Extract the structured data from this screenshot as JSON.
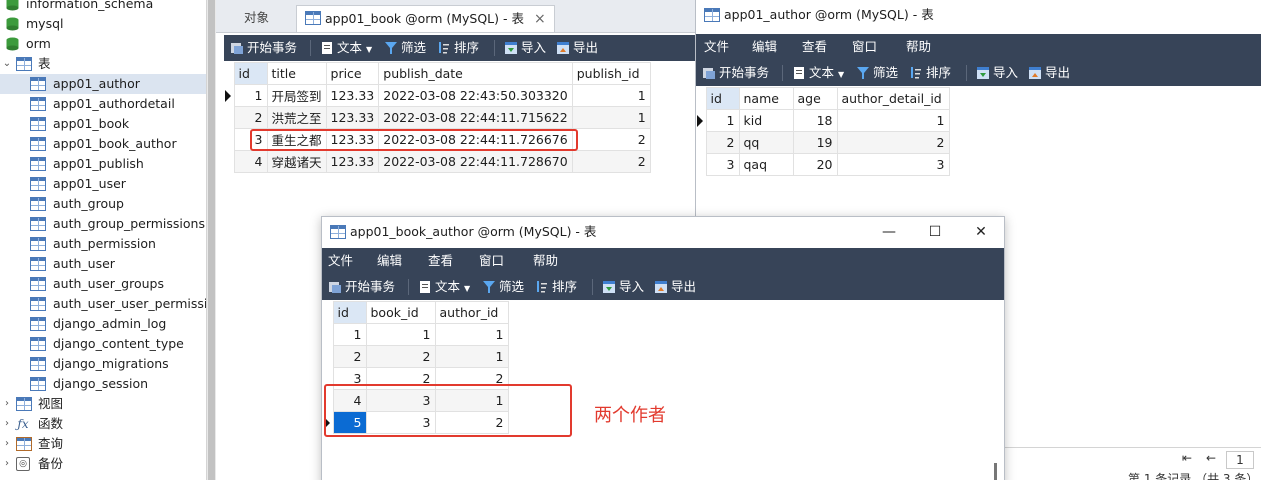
{
  "tree": {
    "top_items": [
      {
        "label": "information_schema",
        "kind": "db"
      },
      {
        "label": "mysql",
        "kind": "db"
      },
      {
        "label": "orm",
        "kind": "db"
      }
    ],
    "group_label": "表",
    "tables": [
      "app01_author",
      "app01_authordetail",
      "app01_book",
      "app01_book_author",
      "app01_publish",
      "app01_user",
      "auth_group",
      "auth_group_permissions",
      "auth_permission",
      "auth_user",
      "auth_user_groups",
      "auth_user_user_permission",
      "django_admin_log",
      "django_content_type",
      "django_migrations",
      "django_session"
    ],
    "bottom_groups": [
      {
        "label": "视图",
        "icon": "view-icon"
      },
      {
        "label": "函数",
        "icon": "function-icon"
      },
      {
        "label": "查询",
        "icon": "query-icon"
      },
      {
        "label": "备份",
        "icon": "backup-icon"
      }
    ]
  },
  "tabs": {
    "objects_label": "对象",
    "active_label": "app01_book @orm (MySQL) - 表"
  },
  "toolbar": {
    "begin_transaction": "开始事务",
    "text": "文本",
    "filter": "筛选",
    "sort": "排序",
    "import": "导入",
    "export": "导出"
  },
  "menu": {
    "file": "文件",
    "edit": "编辑",
    "view": "查看",
    "window": "窗口",
    "help": "帮助"
  },
  "book_table": {
    "columns": [
      "id",
      "title",
      "price",
      "publish_date",
      "publish_id"
    ],
    "rows": [
      [
        "1",
        "开局签到",
        "123.33",
        "2022-03-08 22:43:50.303320",
        "1"
      ],
      [
        "2",
        "洪荒之至",
        "123.33",
        "2022-03-08 22:44:11.715622",
        "1"
      ],
      [
        "3",
        "重生之都",
        "123.33",
        "2022-03-08 22:44:11.726676",
        "2"
      ],
      [
        "4",
        "穿越诸天",
        "123.33",
        "2022-03-08 22:44:11.728670",
        "2"
      ]
    ]
  },
  "author_window": {
    "title": "app01_author @orm (MySQL) - 表",
    "columns": [
      "id",
      "name",
      "age",
      "author_detail_id"
    ],
    "rows": [
      [
        "1",
        "kid",
        "18",
        "1"
      ],
      [
        "2",
        "qq",
        "19",
        "2"
      ],
      [
        "3",
        "qaq",
        "20",
        "3"
      ]
    ],
    "page_number": "1",
    "status_text": "第 1 条记录 （共 3 条）"
  },
  "book_author_window": {
    "title": "app01_book_author @orm (MySQL) - 表",
    "columns": [
      "id",
      "book_id",
      "author_id"
    ],
    "rows": [
      [
        "1",
        "1",
        "1"
      ],
      [
        "2",
        "2",
        "1"
      ],
      [
        "3",
        "2",
        "2"
      ],
      [
        "4",
        "3",
        "1"
      ],
      [
        "5",
        "3",
        "2"
      ]
    ],
    "minimize": "—",
    "maximize": "☐",
    "close": "✕"
  },
  "annotation": "两个作者",
  "colors": {
    "toolbar_bg": "#374458",
    "highlight_red": "#e23a2e",
    "selection_blue": "#0b6bd3"
  }
}
